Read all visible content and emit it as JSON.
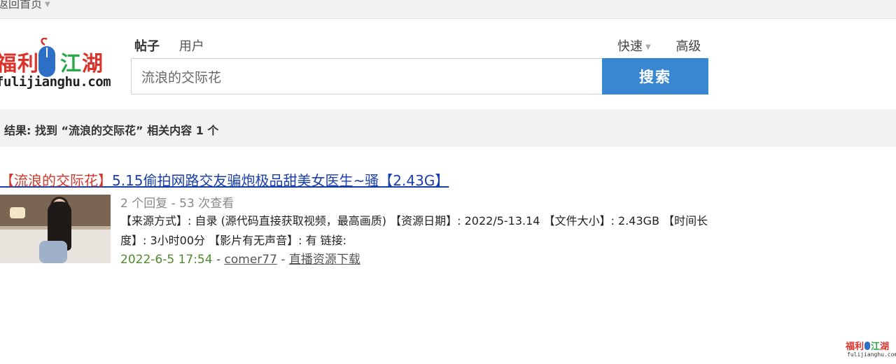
{
  "topbar": {
    "back_home_label": "返回首页"
  },
  "logo": {
    "chars": [
      "福",
      "利",
      "江",
      "湖"
    ],
    "domain_text": "fulijianghu.com",
    "colors": {
      "red": "#d9342b",
      "green": "#2aa84a",
      "blue": "#2d6fc6"
    }
  },
  "search": {
    "tabs": [
      {
        "label": "帖子",
        "active": true
      },
      {
        "label": "用户",
        "active": false
      }
    ],
    "quick_label": "快速",
    "advanced_label": "高级",
    "query_value": "流浪的交际花",
    "button_label": "搜索",
    "button_color": "#3a87d1"
  },
  "results_summary": "结果: 找到 “流浪的交际花” 相关内容 1 个",
  "results": [
    {
      "title_keyword": "【流浪的交际花】",
      "title_rest": "5.15偷拍网路交友骗炮极品甜美女医生~骚【2.43G】",
      "stats": "2 个回复 - 53 次查看",
      "description": "【来源方式】: 自录 (源代码直接获取视频，最高画质) 【资源日期】: 2022/5-13.14 【文件大小】: 2.43GB 【时间长度】: 3小时00分 【影片有无声音】: 有 链接:",
      "date": "2022-6-5 17:54",
      "author": "comer77",
      "separator": "-",
      "forum": "直播资源下载"
    }
  ],
  "watermark": {
    "chars": [
      "福",
      "利",
      "江",
      "湖"
    ],
    "domain_text": "fulijianghu.com"
  }
}
